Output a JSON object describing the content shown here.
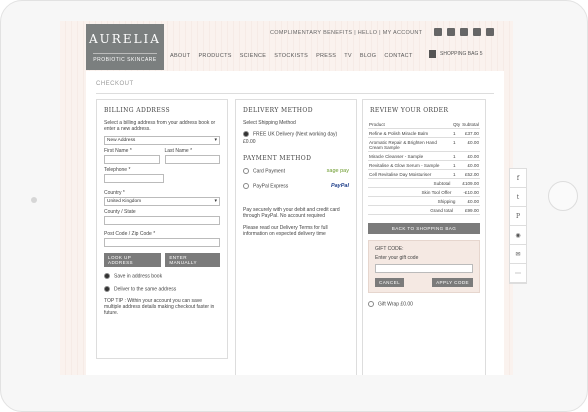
{
  "brand": {
    "name": "AURELIA",
    "tagline": "PROBIOTIC SKINCARE"
  },
  "toplinks": "COMPLIMENTARY BENEFITS  |  HELLO  |  MY ACCOUNT",
  "nav": [
    "ABOUT",
    "PRODUCTS",
    "SCIENCE",
    "STOCKISTS",
    "PRESS",
    "TV",
    "BLOG",
    "CONTACT"
  ],
  "bag": "SHOPPING BAG 5",
  "crumb": "CHECKOUT",
  "billing": {
    "title": "BILLING ADDRESS",
    "intro": "Select a billing address from your address book or enter a new address.",
    "address_select": "New Address",
    "first_name": "First Name *",
    "last_name": "Last Name *",
    "telephone": "Telephone *",
    "country": "Country *",
    "country_value": "United Kingdom",
    "county": "County / State",
    "postcode": "Post Code / Zip Code *",
    "lookup_btn": "LOOK UP ADDRESS",
    "manual_btn": "ENTER MANUALLY",
    "save_label": "Save in address book",
    "deliver_label": "Deliver to the same address",
    "tip": "TOP TIP : Within your account you can save multiple address details making checkout faster in future."
  },
  "delivery": {
    "title": "DELIVERY METHOD",
    "select_label": "Select Shipping Method",
    "option": "FREE UK Delivery (Next working day)",
    "price": "£0.00",
    "payment_title": "PAYMENT METHOD",
    "card": "Card Payment",
    "paypal": "PayPal Express",
    "sagepay": "sage pay",
    "paypal_logo": "PayPal",
    "note1": "Pay securely with your debit and credit card through PayPal. No account required",
    "note2": "Please read our Delivery Terms for full information on expected delivery time"
  },
  "review": {
    "title": "REVIEW YOUR ORDER",
    "headers": [
      "Product",
      "Qty",
      "Subtotal"
    ],
    "rows": [
      {
        "product": "Refine & Polish Miracle Balm",
        "qty": "1",
        "subtotal": "£37.00"
      },
      {
        "product": "Aromatic Repair & Brighten Hand Cream Sample",
        "qty": "1",
        "subtotal": "£0.00"
      },
      {
        "product": "Miracle Cleanser - Sample",
        "qty": "1",
        "subtotal": "£0.00"
      },
      {
        "product": "Revitalise & Glow Serum - Sample",
        "qty": "1",
        "subtotal": "£0.00"
      },
      {
        "product": "Cell Revitalise Day Moisturiser",
        "qty": "1",
        "subtotal": "£52.00"
      }
    ],
    "subtotal_label": "Subtotal",
    "subtotal": "£109.00",
    "skin_label": "Skin Tool Offer",
    "skin": "-£10.00",
    "shipping_label": "Shipping",
    "shipping": "£0.00",
    "grand_label": "Grand total",
    "grand": "£99.00",
    "back_btn": "BACK TO SHOPPING BAG",
    "gift_title": "GIFT CODE:",
    "gift_prompt": "Enter your gift code",
    "cancel_btn": "CANCEL",
    "apply_btn": "APPLY CODE",
    "gift_wrap": "Gift Wrap £0.00"
  },
  "share": [
    "f",
    "t",
    "P",
    "◉",
    "✉",
    "⋯"
  ]
}
